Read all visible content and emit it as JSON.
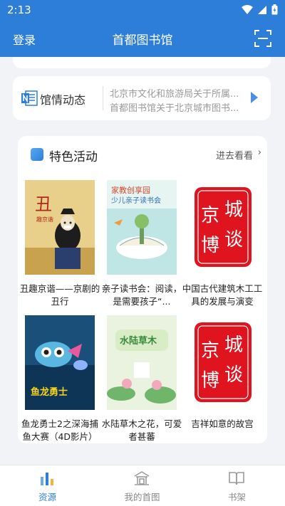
{
  "status_bar": {
    "time": "2:13"
  },
  "header": {
    "left_action": "登录",
    "title": "首都图书馆",
    "right_icon": "scan-icon"
  },
  "news": {
    "label": "馆情动态",
    "items": [
      "北京市文化和旅游局关于所属...",
      "首都图书馆关于北京城市图书..."
    ]
  },
  "activities": {
    "title": "特色活动",
    "more": "进去看看",
    "items": [
      {
        "title": "丑趣京谐——京剧的丑行",
        "poster": "opera-poster"
      },
      {
        "title": "亲子读书会：阅读，是需要孩子“...",
        "poster": "reading-poster"
      },
      {
        "title": "中国古代建筑木工工具的发展与演变",
        "poster": "jingcheng-botan-poster"
      },
      {
        "title": "鱼龙勇士2之深海捕鱼大赛（4D影片）",
        "poster": "film-poster"
      },
      {
        "title": "水陆草木之花，可爱者甚蕃",
        "poster": "flower-poster"
      },
      {
        "title": "吉祥如意的故宫",
        "poster": "jingcheng-botan-poster"
      }
    ],
    "poster_texts": {
      "opera": "丑",
      "opera_sub": "趣京谐",
      "reading_top": "家教创享园",
      "reading_sub": "少儿亲子读书会",
      "botan_chars": [
        "京",
        "城",
        "博",
        "谈"
      ],
      "film": "鱼龙勇士",
      "flower": "水陆草木"
    }
  },
  "tabbar": {
    "tabs": [
      {
        "label": "资源",
        "active": true
      },
      {
        "label": "我的首图",
        "active": false
      },
      {
        "label": "书架",
        "active": false
      }
    ]
  },
  "colors": {
    "primary": "#2d7ed9",
    "botan_red": "#e0141e"
  }
}
